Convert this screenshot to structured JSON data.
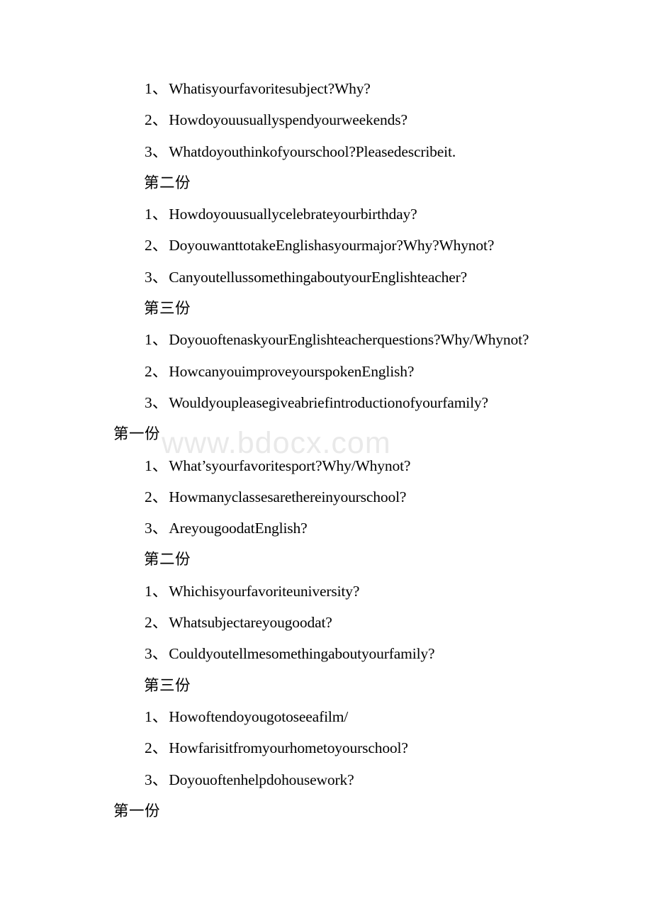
{
  "document": {
    "watermark": "www.bdocx.com",
    "enum_mark": "、",
    "page_background": "#ffffff",
    "text_color": "#000000",
    "watermark_color": "#e9e9e9"
  },
  "lines": [
    {
      "kind": "question",
      "number": "1",
      "text": "Whatisyourfavoritesubject?Why?"
    },
    {
      "kind": "question",
      "number": "2",
      "text": "Howdoyouusuallyspendyourweekends?"
    },
    {
      "kind": "question",
      "number": "3",
      "text": "Whatdoyouthinkofyourschool?Pleasedescribeit."
    },
    {
      "kind": "heading-indent",
      "number": "",
      "text": "第二份"
    },
    {
      "kind": "question",
      "number": "1",
      "text": "Howdoyouusuallycelebrateyourbirthday?"
    },
    {
      "kind": "question",
      "number": "2",
      "text": "DoyouwanttotakeEnglishasyourmajor?Why?Whynot?"
    },
    {
      "kind": "question",
      "number": "3",
      "text": "CanyoutellussomethingaboutyourEnglishteacher?"
    },
    {
      "kind": "heading-indent",
      "number": "",
      "text": "第三份"
    },
    {
      "kind": "question",
      "number": "1",
      "text": "DoyouoftenaskyourEnglishteacherquestions?Why/Whynot?"
    },
    {
      "kind": "question",
      "number": "2",
      "text": "HowcanyouimproveyourspokenEnglish?"
    },
    {
      "kind": "question",
      "number": "3",
      "text": "Wouldyoupleasegiveabriefintroductionofyourfamily?"
    },
    {
      "kind": "heading-top",
      "number": "",
      "text": "第一份"
    },
    {
      "kind": "question",
      "number": "1",
      "text": "What’syourfavoritesport?Why/Whynot?"
    },
    {
      "kind": "question",
      "number": "2",
      "text": "Howmanyclassesarethereinyourschool?"
    },
    {
      "kind": "question",
      "number": "3",
      "text": "AreyougoodatEnglish?"
    },
    {
      "kind": "heading-indent",
      "number": "",
      "text": "第二份"
    },
    {
      "kind": "question",
      "number": "1",
      "text": "Whichisyourfavoriteuniversity?"
    },
    {
      "kind": "question",
      "number": "2",
      "text": "Whatsubjectareyougoodat?"
    },
    {
      "kind": "question",
      "number": "3",
      "text": "Couldyoutellmesomethingaboutyourfamily?"
    },
    {
      "kind": "heading-indent",
      "number": "",
      "text": "第三份"
    },
    {
      "kind": "question",
      "number": "1",
      "text": "Howoftendoyougotoseeafilm/"
    },
    {
      "kind": "question",
      "number": "2",
      "text": "Howfarisitfromyourhometoyourschool?"
    },
    {
      "kind": "question",
      "number": "3",
      "text": "Doyouoftenhelpdohousework?"
    },
    {
      "kind": "heading-top",
      "number": "",
      "text": "第一份"
    }
  ]
}
